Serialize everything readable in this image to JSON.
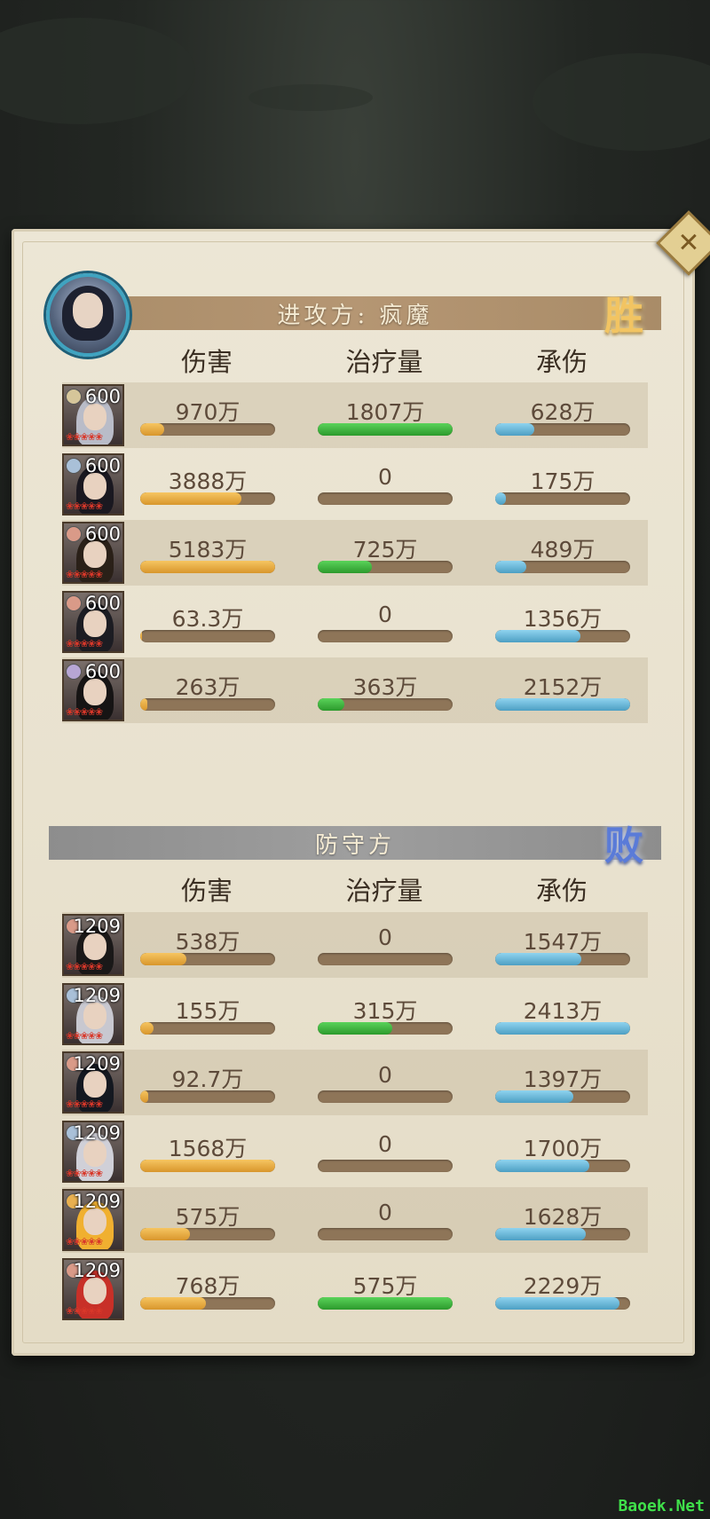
{
  "attacker": {
    "title": "进攻方: 疯魔",
    "result": "胜",
    "columns": [
      "伤害",
      "治疗量",
      "承伤"
    ],
    "rows": [
      {
        "level": "600",
        "damage": "970万",
        "damage_pct": 0.18,
        "heal": "1807万",
        "heal_pct": 1.0,
        "taken": "628万",
        "taken_pct": 0.29,
        "faction_color": "#d6c69a",
        "hair": "#b9bcc8"
      },
      {
        "level": "600",
        "damage": "3888万",
        "damage_pct": 0.75,
        "heal": "0",
        "heal_pct": 0,
        "taken": "175万",
        "taken_pct": 0.08,
        "faction_color": "#a9c0d8",
        "hair": "#1a1820"
      },
      {
        "level": "600",
        "damage": "5183万",
        "damage_pct": 1.0,
        "heal": "725万",
        "heal_pct": 0.4,
        "taken": "489万",
        "taken_pct": 0.23,
        "faction_color": "#d99a88",
        "hair": "#2a2018"
      },
      {
        "level": "600",
        "damage": "63.3万",
        "damage_pct": 0.01,
        "heal": "0",
        "heal_pct": 0,
        "taken": "1356万",
        "taken_pct": 0.63,
        "faction_color": "#d99a88",
        "hair": "#1c1c22"
      },
      {
        "level": "600",
        "damage": "263万",
        "damage_pct": 0.05,
        "heal": "363万",
        "heal_pct": 0.2,
        "taken": "2152万",
        "taken_pct": 1.0,
        "faction_color": "#b7a6d4",
        "hair": "#161414"
      }
    ]
  },
  "defender": {
    "title": "防守方",
    "result": "败",
    "columns": [
      "伤害",
      "治疗量",
      "承伤"
    ],
    "rows": [
      {
        "level": "1209",
        "damage": "538万",
        "damage_pct": 0.34,
        "heal": "0",
        "heal_pct": 0,
        "taken": "1547万",
        "taken_pct": 0.64,
        "faction_color": "#d99a88",
        "hair": "#1a1818"
      },
      {
        "level": "1209",
        "damage": "155万",
        "damage_pct": 0.1,
        "heal": "315万",
        "heal_pct": 0.55,
        "taken": "2413万",
        "taken_pct": 1.0,
        "faction_color": "#a9c0d8",
        "hair": "#c8c8d0"
      },
      {
        "level": "1209",
        "damage": "92.7万",
        "damage_pct": 0.06,
        "heal": "0",
        "heal_pct": 0,
        "taken": "1397万",
        "taken_pct": 0.58,
        "faction_color": "#d99a88",
        "hair": "#141820"
      },
      {
        "level": "1209",
        "damage": "1568万",
        "damage_pct": 1.0,
        "heal": "0",
        "heal_pct": 0,
        "taken": "1700万",
        "taken_pct": 0.7,
        "faction_color": "#a9c0d8",
        "hair": "#d0d0d8"
      },
      {
        "level": "1209",
        "damage": "575万",
        "damage_pct": 0.37,
        "heal": "0",
        "heal_pct": 0,
        "taken": "1628万",
        "taken_pct": 0.67,
        "faction_color": "#e8b050",
        "hair": "#f0b030"
      },
      {
        "level": "1209",
        "damage": "768万",
        "damage_pct": 0.49,
        "heal": "575万",
        "heal_pct": 1.0,
        "taken": "2229万",
        "taken_pct": 0.92,
        "faction_color": "#d99a88",
        "hair": "#c83028"
      }
    ]
  },
  "watermark": "Baoek.Net",
  "colors": {
    "damage": "#e0a83a",
    "heal": "#3cb43c",
    "taken": "#64b4d6",
    "win": "#f2c462",
    "lose": "#5a7bd8"
  }
}
